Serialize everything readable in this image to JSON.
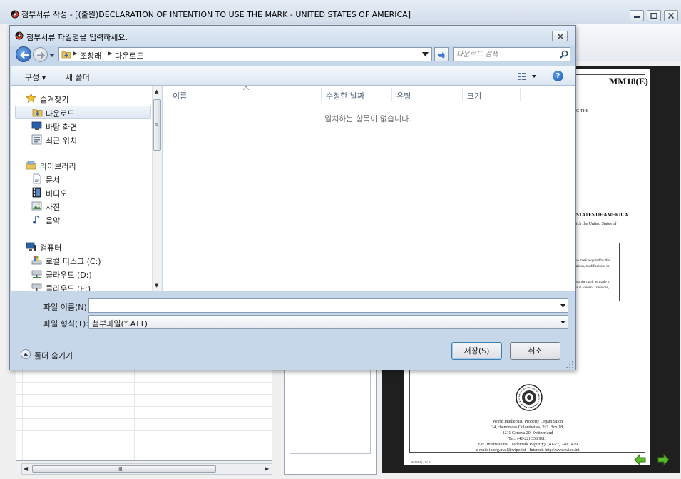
{
  "parent_window": {
    "title": "첨부서류 작성 - [(출원)DECLARATION OF INTENTION TO USE THE MARK - UNITED STATES OF AMERICA]"
  },
  "document_preview": {
    "form_code": "MM18(E)",
    "fragment_1": "G THE",
    "heading_fragment": "STATES OF AMERICA",
    "fragment_2": "ich the United States of",
    "box_line_1": "he mark required by the",
    "box_line_2": "ations, modifications or",
    "box_line_3": "use the mark be made in",
    "box_line_4": "is in French.  Therefore,",
    "footer_1": "World Intellectual Property Organization",
    "footer_2": "34, chemin des Colombettes, P.O. Box 18,",
    "footer_3": "1211 Geneva 20, Switzerland",
    "footer_4": "Tel.: (41-22) 338 9111",
    "footer_5": "Fax (International Trademark Registry): (41-22) 740 1429",
    "footer_6": "e-mail: intreg.mail@wipo.int - Internet: http://www.wipo.int",
    "page_id": "MM18(E) - IV 04"
  },
  "dialog": {
    "title": "첨부서류 파일명을 입력하세요.",
    "address": {
      "segment_1": "조창래",
      "segment_2": "다운로드"
    },
    "search": {
      "placeholder": "다운로드 검색"
    },
    "toolbar": {
      "organize_label": "구성 ▾",
      "new_folder_label": "새 폴더"
    },
    "nav": {
      "favorites": {
        "header": "즐겨찾기",
        "items": [
          {
            "label": "다운로드",
            "icon": "downloads-folder-icon",
            "selected": true
          },
          {
            "label": "바탕 화면",
            "icon": "desktop-icon"
          },
          {
            "label": "최근 위치",
            "icon": "recent-places-icon"
          }
        ]
      },
      "libraries": {
        "header": "라이브러리",
        "items": [
          {
            "label": "문서",
            "icon": "documents-icon"
          },
          {
            "label": "비디오",
            "icon": "videos-icon"
          },
          {
            "label": "사진",
            "icon": "pictures-icon"
          },
          {
            "label": "음악",
            "icon": "music-icon"
          }
        ]
      },
      "computer": {
        "header": "컴퓨터",
        "items": [
          {
            "label": "로컬 디스크 (C:)",
            "icon": "local-disk-icon"
          },
          {
            "label": "클라우드 (D:)",
            "icon": "network-drive-icon"
          },
          {
            "label": "클라우드 (E:)",
            "icon": "network-drive-icon"
          }
        ]
      }
    },
    "columns": [
      "이름",
      "수정한 날짜",
      "유형",
      "크기"
    ],
    "empty_message": "일치하는 항목이 없습니다.",
    "file_name": {
      "label": "파일 이름(N):",
      "value": ""
    },
    "file_type": {
      "label": "파일 형식(T):",
      "value": "첨부파일(*.ATT)"
    },
    "hide_folders_label": "폴더 숨기기",
    "save_label": "저장(S)",
    "cancel_label": "취소"
  },
  "colors": {
    "accent": "#1f5fb3",
    "dialog_frame": "#c7d7ea",
    "nav_arrow": "#5cb82e"
  }
}
